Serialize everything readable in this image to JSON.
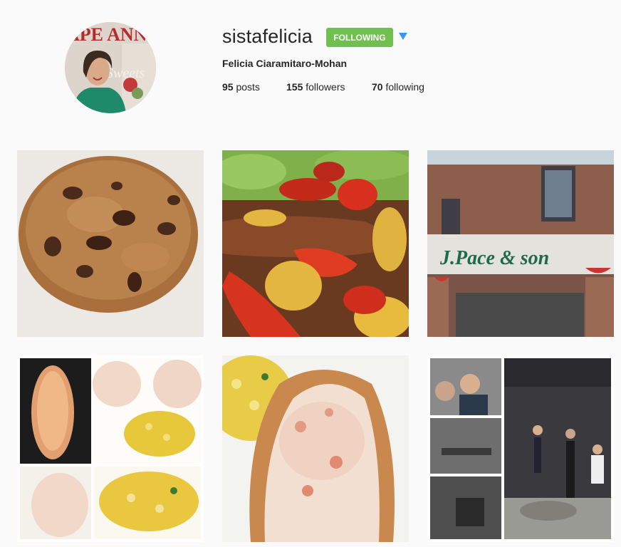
{
  "profile": {
    "username": "sistafelicia",
    "follow_button": "FOLLOWING",
    "full_name": "Felicia Ciaramitaro-Mohan",
    "stats": {
      "posts_count": "95",
      "posts_label": "posts",
      "followers_count": "155",
      "followers_label": "followers",
      "following_count": "70",
      "following_label": "following"
    },
    "avatar_magazine_title": "APE ANN",
    "avatar_magazine_subtitle": "Sweets"
  },
  "posts": [
    {
      "name": "chocolate-chip-cookie"
    },
    {
      "name": "sausage-peppers-salad"
    },
    {
      "name": "storefront",
      "sign_text": "J.Pace & son"
    },
    {
      "name": "lobster-roll-collage"
    },
    {
      "name": "lobster-roll-corn"
    },
    {
      "name": "studio-collage"
    }
  ],
  "colors": {
    "follow_green": "#70c050",
    "arrow_blue": "#3897f0",
    "text": "#262626",
    "background": "#fafafa"
  }
}
